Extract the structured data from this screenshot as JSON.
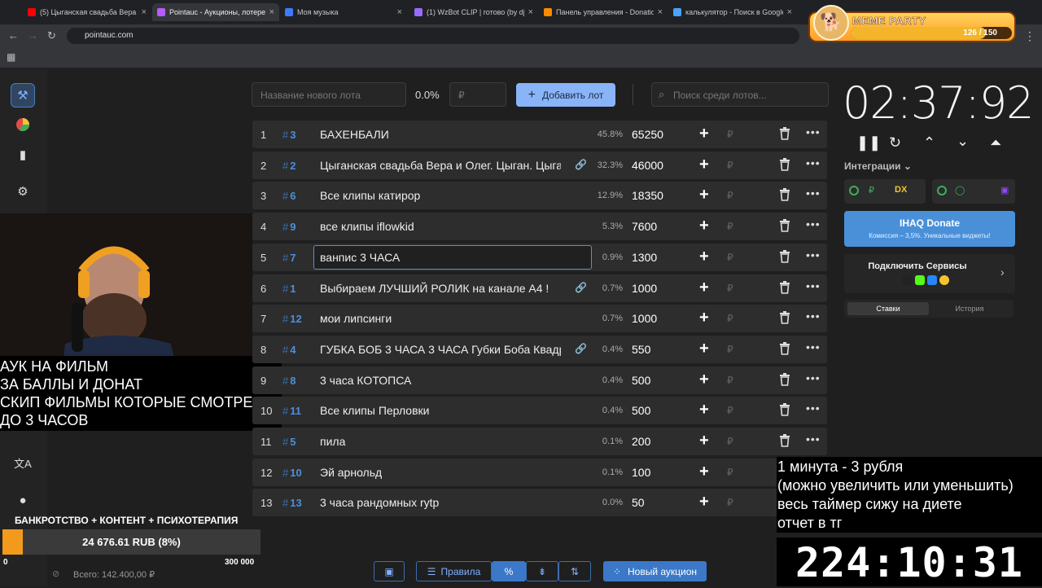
{
  "browser": {
    "tabs": [
      {
        "title": "(5) Цыганская свадьба Вера и",
        "color": "#ff0000"
      },
      {
        "title": "Pointauc - Аукционы, лотереи",
        "color": "#b45cff"
      },
      {
        "title": "Моя музыка",
        "color": "#3b7cff"
      },
      {
        "title": "(1) WzBot CLIP | готово (by dj",
        "color": "#9a6bff"
      },
      {
        "title": "Панель управления - Donation",
        "color": "#ff8a00"
      },
      {
        "title": "калькулятор - Поиск в Google",
        "color": "#4aa3ff"
      }
    ],
    "url": "pointauc.com"
  },
  "meme_party": {
    "title": "MEME PARTY",
    "progress": "126 / 150",
    "progress_fraction": 0.84
  },
  "controls": {
    "new_lot_placeholder": "Название нового лота",
    "percent": "0.0%",
    "currency_placeholder": "₽",
    "add_lot": "Добавить лот",
    "search_placeholder": "Поиск среди лотов..."
  },
  "lots": [
    {
      "n": "1",
      "id": "3",
      "name": "БАХЕНБАЛИ",
      "pct": "45.8%",
      "amount": "65250",
      "link": false
    },
    {
      "n": "2",
      "id": "2",
      "name": "Цыганская свадьба Вера и Олег. Цыган. Цыга",
      "pct": "32.3%",
      "amount": "46000",
      "link": true
    },
    {
      "n": "3",
      "id": "6",
      "name": "Все клипы катирор",
      "pct": "12.9%",
      "amount": "18350",
      "link": false
    },
    {
      "n": "4",
      "id": "9",
      "name": "все клипы iflowkid",
      "pct": "5.3%",
      "amount": "7600",
      "link": false
    },
    {
      "n": "5",
      "id": "7",
      "name": "ванпис 3 ЧАСА",
      "pct": "0.9%",
      "amount": "1300",
      "link": false,
      "editing": true
    },
    {
      "n": "6",
      "id": "1",
      "name": "Выбираем ЛУЧШИЙ РОЛИК на канале А4 !",
      "pct": "0.7%",
      "amount": "1000",
      "link": true
    },
    {
      "n": "7",
      "id": "12",
      "name": "мои липсинги",
      "pct": "0.7%",
      "amount": "1000",
      "link": false
    },
    {
      "n": "8",
      "id": "4",
      "name": "ГУБКА БОБ 3 ЧАСА 3 ЧАСА Губки Боба Квадр",
      "pct": "0.4%",
      "amount": "550",
      "link": true
    },
    {
      "n": "9",
      "id": "8",
      "name": "3 часа КОТОПСА",
      "pct": "0.4%",
      "amount": "500",
      "link": false
    },
    {
      "n": "10",
      "id": "11",
      "name": "Все клипы Перловки",
      "pct": "0.4%",
      "amount": "500",
      "link": false
    },
    {
      "n": "11",
      "id": "5",
      "name": "пила",
      "pct": "0.1%",
      "amount": "200",
      "link": false
    },
    {
      "n": "12",
      "id": "10",
      "name": "Эй арнольд",
      "pct": "0.1%",
      "amount": "100",
      "link": false
    },
    {
      "n": "13",
      "id": "13",
      "name": "3 часа рандомных rytp",
      "pct": "0.0%",
      "amount": "50",
      "link": false
    }
  ],
  "ruble": "₽",
  "timer": "02:37:92",
  "integrations": {
    "label": "Интеграции",
    "ihaq_title": "IHAQ Donate",
    "ihaq_sub": "Комиссия – 3,5%. Уникальные виджеты!",
    "connect": "Подключить Сервисы",
    "tab_bets": "Ставки",
    "tab_history": "История"
  },
  "overlay": {
    "lines": [
      "АУК НА ФИЛЬМ",
      "ЗА БАЛЛЫ И ДОНАТ",
      "СКИП ФИЛЬМЫ КОТОРЫЕ СМОТРЕЛ",
      "ДО 3 ЧАСОВ"
    ]
  },
  "rules_overlay": {
    "lines": [
      "1 минута - 3 рубля",
      "(можно увеличить или уменьшить)",
      "весь таймер сижу на диете",
      "отчет в тг"
    ]
  },
  "big_clock": "224:10:31",
  "donation_goal": {
    "title": "БАНКРОТСТВО + КОНТЕНТ + ПСИХОТЕРАПИЯ",
    "value": "24 676.61 RUB (8%)",
    "fraction": 0.08,
    "min": "0",
    "max": "300 000"
  },
  "total": "Всего: 142.400,00 ₽",
  "bottom": {
    "rules": "Правила",
    "new_auction": "Новый аукцион"
  }
}
